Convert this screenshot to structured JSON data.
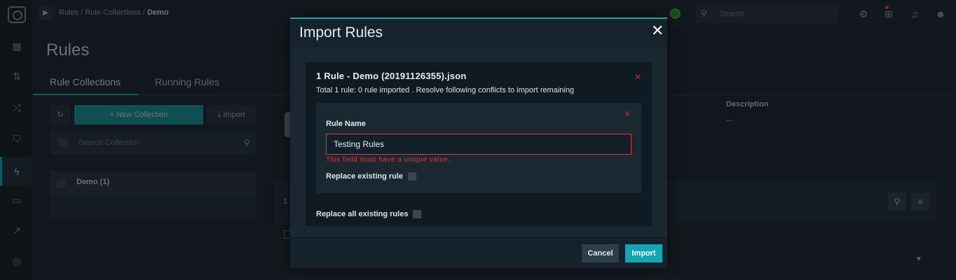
{
  "colors": {
    "accent": "#14a6b2",
    "error": "#e0383d",
    "modal_bg": "#1a2630",
    "card_bg": "#0f1a22"
  },
  "topbar": {
    "breadcrumb": {
      "part1": "Rules",
      "sep1": "/",
      "part2": "Rule Collections",
      "sep2": "/",
      "current": "Demo"
    },
    "search_placeholder": "Search"
  },
  "page": {
    "title": "Rules",
    "tabs": [
      {
        "label": "Rule Collections",
        "active": true
      },
      {
        "label": "Running Rules",
        "active": false
      }
    ]
  },
  "collections": {
    "new_label": "New Collection",
    "import_label": "Import",
    "search_placeholder": "Search Collection",
    "items": [
      {
        "name": "Demo (1)"
      }
    ]
  },
  "details": {
    "description_label": "Description",
    "description_value": "--",
    "grid_count": "1"
  },
  "modal": {
    "title": "Import Rules",
    "file": {
      "name": "1 Rule - Demo (20191126355).json",
      "summary": "Total 1 rule: 0 rule imported . Resolve following conflicts to import remaining"
    },
    "conflict": {
      "field_label": "Rule Name",
      "field_value": "Testing Rules",
      "error": "This field must have a unique value.",
      "replace_label": "Replace existing rule"
    },
    "replace_all_label": "Replace all existing rules",
    "cancel_label": "Cancel",
    "import_label": "Import"
  }
}
